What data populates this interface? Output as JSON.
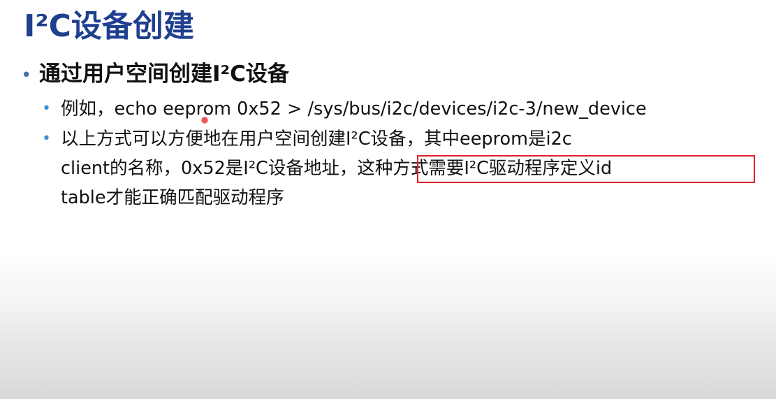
{
  "slide": {
    "title": "I²C设备创建",
    "bullet1": "通过用户空间创建I²C设备",
    "sub1": "例如，echo eeprom 0x52 > /sys/bus/i2c/devices/i2c-3/new_device",
    "sub2_line1": "以上方式可以方便地在用户空间创建I²C设备，其中eeprom是i2c",
    "sub2_line2": "client的名称，0x52是I²C设备地址，这种方式需要I²C驱动程序定义id",
    "sub2_line3": "table才能正确匹配驱动程序",
    "highlighted_text": "这种方式需要I²C驱动程序定义id"
  },
  "colors": {
    "title": "#1f3f8f",
    "bullet_dot": "#4a6fa8",
    "sub_bullet_dot": "#3d8fd1",
    "highlight_border": "#e0202a",
    "cursor": "#ff4a4a"
  },
  "bullets": {
    "level1_glyph": "•",
    "level2_glyph": "•"
  }
}
